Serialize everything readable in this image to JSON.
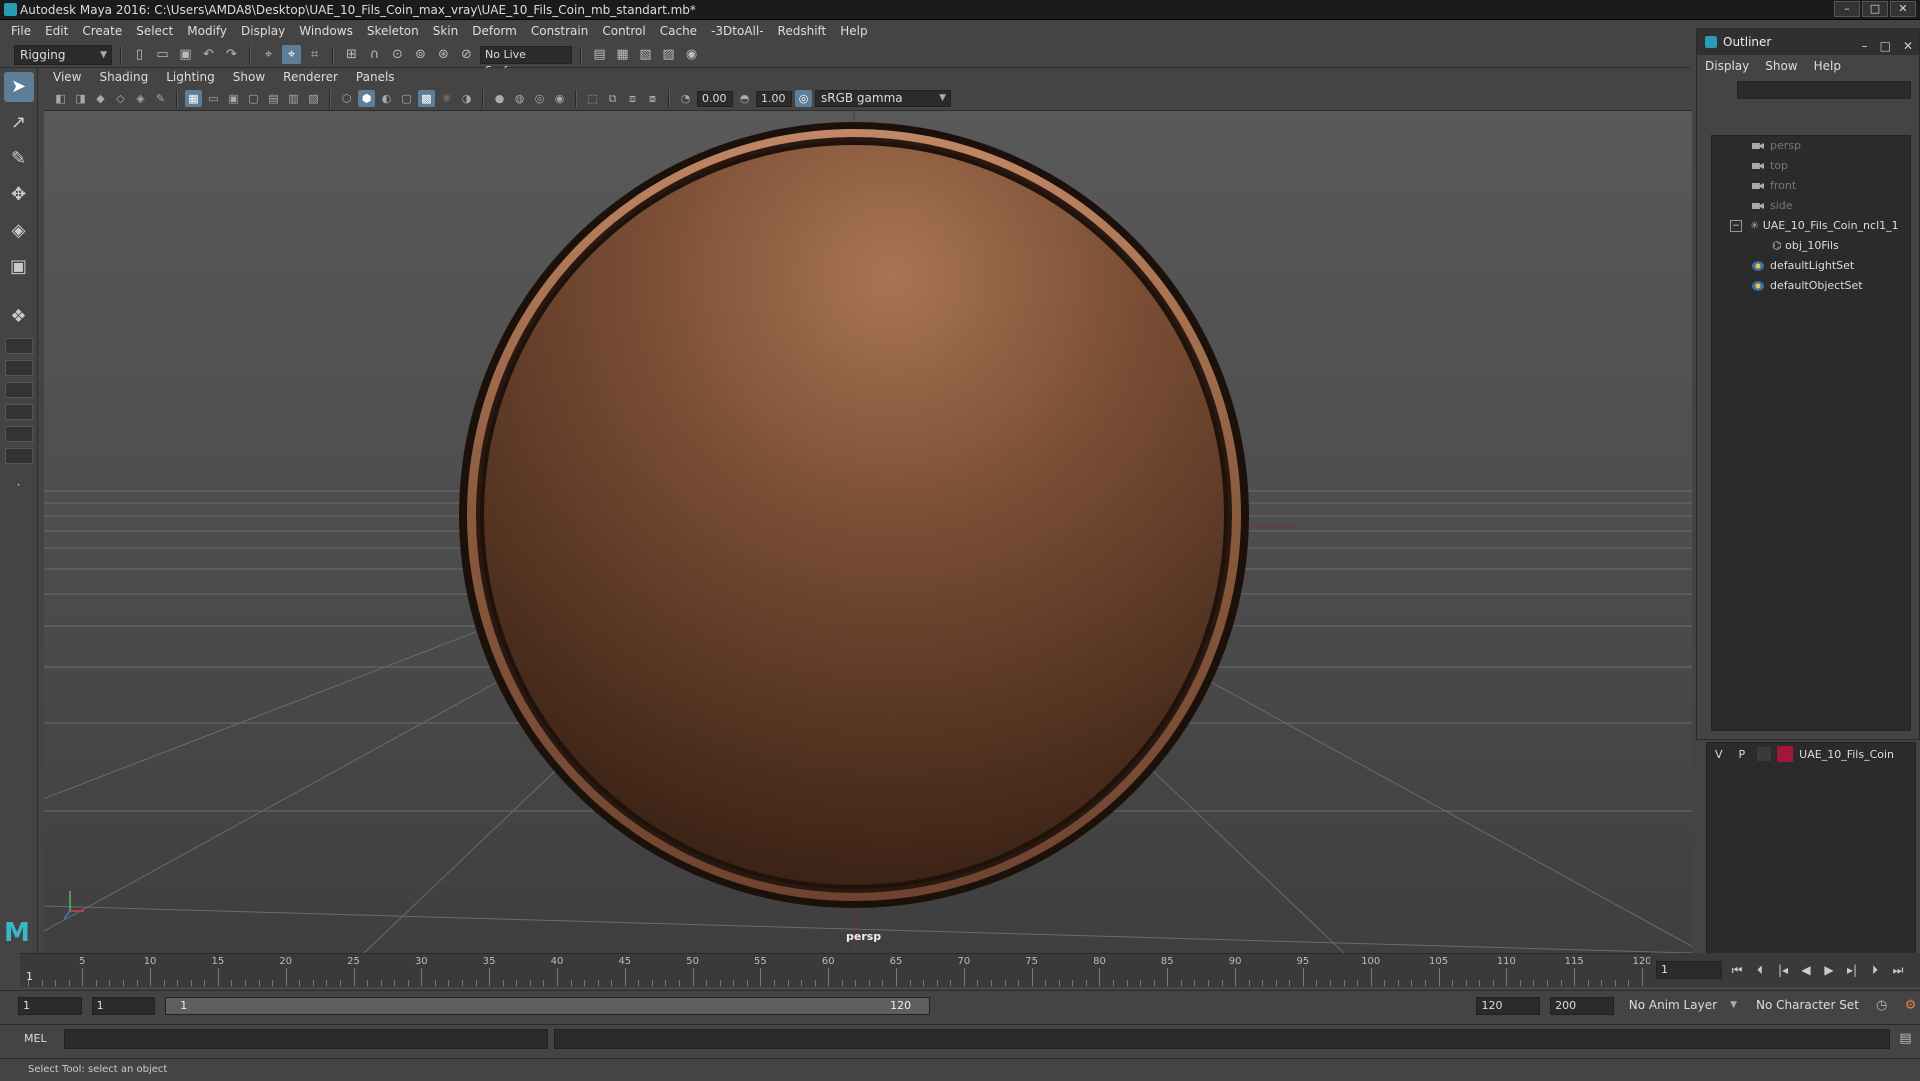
{
  "window": {
    "title": "Autodesk Maya 2016: C:\\Users\\AMDA8\\Desktop\\UAE_10_Fils_Coin_max_vray\\UAE_10_Fils_Coin_mb_standart.mb*"
  },
  "menubar": [
    "File",
    "Edit",
    "Create",
    "Select",
    "Modify",
    "Display",
    "Windows",
    "Skeleton",
    "Skin",
    "Deform",
    "Constrain",
    "Control",
    "Cache",
    "-3DtoAll-",
    "Redshift",
    "Help"
  ],
  "shelf": {
    "mode": "Rigging",
    "live_surface": "No Live Surface"
  },
  "viewport": {
    "menu": [
      "View",
      "Shading",
      "Lighting",
      "Show",
      "Renderer",
      "Panels"
    ],
    "exposure": "0.00",
    "gamma": "1.00",
    "color_space": "sRGB gamma",
    "camera_label": "persp"
  },
  "outliner": {
    "title": "Outliner",
    "menu": [
      "Display",
      "Show",
      "Help"
    ],
    "items": [
      {
        "label": "persp",
        "type": "camera",
        "dim": true
      },
      {
        "label": "top",
        "type": "camera",
        "dim": true
      },
      {
        "label": "front",
        "type": "camera",
        "dim": true
      },
      {
        "label": "side",
        "type": "camera",
        "dim": true
      },
      {
        "label": "UAE_10_Fils_Coin_ncl1_1",
        "type": "group",
        "dim": false
      },
      {
        "label": "obj_10Fils",
        "type": "mesh",
        "dim": false
      },
      {
        "label": "defaultLightSet",
        "type": "set",
        "dim": false
      },
      {
        "label": "defaultObjectSet",
        "type": "set",
        "dim": false
      }
    ]
  },
  "layer": {
    "v": "V",
    "p": "P",
    "name": "UAE_10_Fils_Coin",
    "color": "#a0173a"
  },
  "timeline": {
    "ticks": [
      "5",
      "10",
      "15",
      "20",
      "25",
      "30",
      "35",
      "40",
      "45",
      "50",
      "55",
      "60",
      "65",
      "70",
      "75",
      "80",
      "85",
      "90",
      "95",
      "100",
      "105",
      "110",
      "115",
      "120"
    ],
    "current_frame": "1",
    "frame_field": "1"
  },
  "range": {
    "start": "1",
    "playback_start": "1",
    "slider_start": "1",
    "slider_end": "120",
    "playback_end": "120",
    "end": "200",
    "anim_layer": "No Anim Layer",
    "character_set": "No Character Set"
  },
  "command": {
    "lang": "MEL"
  },
  "help_line": "Select Tool: select an object"
}
